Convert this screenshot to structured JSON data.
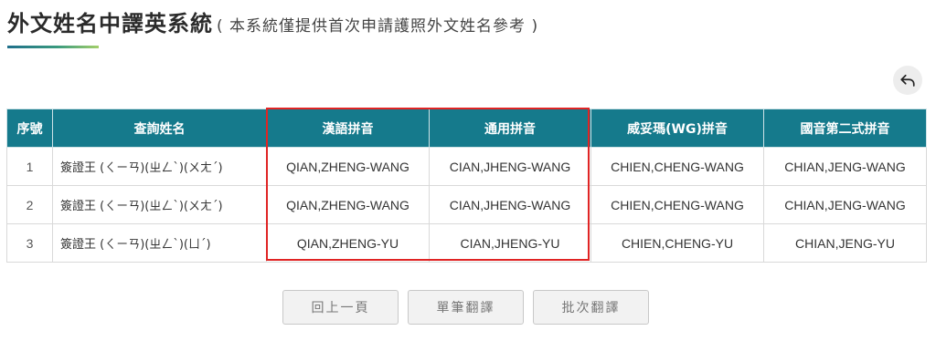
{
  "header": {
    "title": "外文姓名中譯英系統",
    "subtitle": "( 本系統僅提供首次申請護照外文姓名參考 )"
  },
  "back_button": {
    "icon": "undo-arrow-icon"
  },
  "table": {
    "headers": [
      "序號",
      "查詢姓名",
      "漢語拼音",
      "通用拼音",
      "威妥瑪(WG)拼音",
      "國音第二式拼音"
    ],
    "rows": [
      [
        "1",
        "簽證王 (ㄑㄧㄢ)(ㄓㄥˋ)(ㄨㄤˊ)",
        "QIAN,ZHENG-WANG",
        "CIAN,JHENG-WANG",
        "CHIEN,CHENG-WANG",
        "CHIAN,JENG-WANG"
      ],
      [
        "2",
        "簽證王 (ㄑㄧㄢ)(ㄓㄥˋ)(ㄨㄤˊ)",
        "QIAN,ZHENG-WANG",
        "CIAN,JHENG-WANG",
        "CHIEN,CHENG-WANG",
        "CHIAN,JENG-WANG"
      ],
      [
        "3",
        "簽證王 (ㄑㄧㄢ)(ㄓㄥˋ)(ㄩˊ)",
        "QIAN,ZHENG-YU",
        "CIAN,JHENG-YU",
        "CHIEN,CHENG-YU",
        "CHIAN,JENG-YU"
      ]
    ]
  },
  "highlight": {
    "color": "#e02424"
  },
  "buttons": {
    "back_page": "回上一頁",
    "single_translate": "單筆翻譯",
    "batch_translate": "批次翻譯"
  },
  "colors": {
    "header_bg": "#157a8c",
    "highlight_border": "#e02424"
  }
}
